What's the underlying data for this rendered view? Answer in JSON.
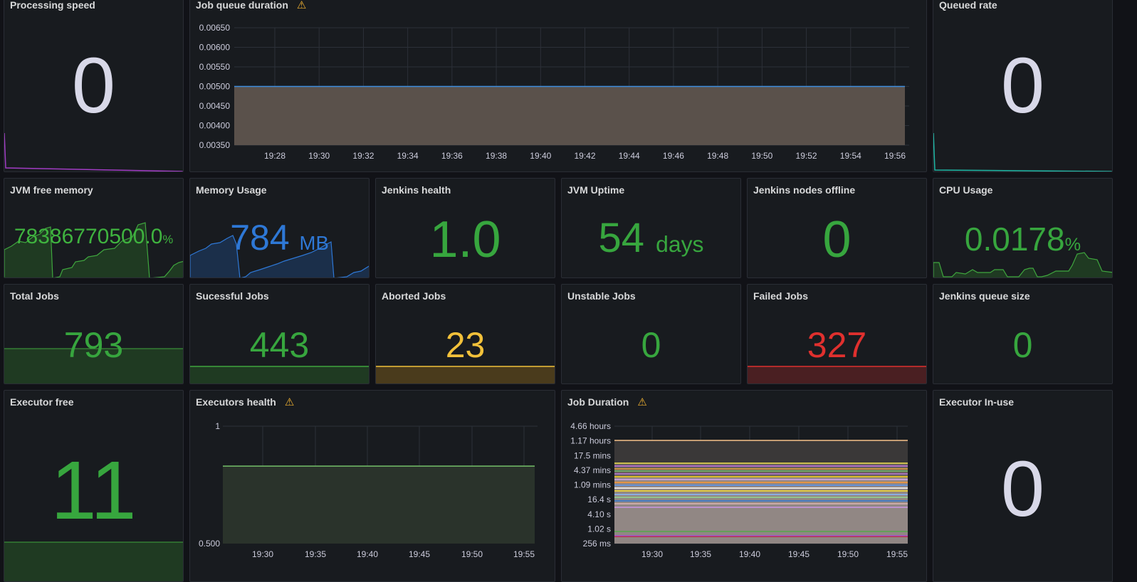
{
  "colors": {
    "background": "#111217",
    "panel": "#181b1f",
    "green": "#37a63e",
    "green_bright": "#3fb33f",
    "blue": "#2e78d6",
    "yellow": "#f2c13a",
    "red": "#e0302e",
    "neutral": "#d8d8e8",
    "warning": "#f2b331"
  },
  "panels": {
    "processing_speed": {
      "title": "Processing speed",
      "value": "0"
    },
    "job_queue_duration": {
      "title": "Job queue duration",
      "warning_icon": "warning-icon"
    },
    "queued_rate": {
      "title": "Queued rate",
      "value": "0"
    },
    "jvm_free_memory": {
      "title": "JVM free memory",
      "value": "78386770500.0",
      "unit": "%"
    },
    "memory_usage": {
      "title": "Memory Usage",
      "value": "784",
      "unit": "MB"
    },
    "jenkins_health": {
      "title": "Jenkins health",
      "value": "1.0"
    },
    "jvm_uptime": {
      "title": "JVM Uptime",
      "value": "54",
      "unit": "days"
    },
    "jenkins_nodes_offline": {
      "title": "Jenkins nodes offline",
      "value": "0"
    },
    "cpu_usage": {
      "title": "CPU Usage",
      "value": "0.0178",
      "unit": "%"
    },
    "total_jobs": {
      "title": "Total Jobs",
      "value": "793"
    },
    "successful_jobs": {
      "title": "Sucessful Jobs",
      "value": "443"
    },
    "aborted_jobs": {
      "title": "Aborted Jobs",
      "value": "23"
    },
    "unstable_jobs": {
      "title": "Unstable Jobs",
      "value": "0"
    },
    "failed_jobs": {
      "title": "Failed Jobs",
      "value": "327"
    },
    "jenkins_queue_size": {
      "title": "Jenkins queue size",
      "value": "0"
    },
    "executor_free": {
      "title": "Executor free",
      "value": "11"
    },
    "executors_health": {
      "title": "Executors health",
      "warning_icon": "warning-icon"
    },
    "job_duration": {
      "title": "Job Duration",
      "warning_icon": "warning-icon"
    },
    "executor_in_use": {
      "title": "Executor In-use",
      "value": "0"
    }
  },
  "chart_data": [
    {
      "type": "area",
      "panel": "Job queue duration",
      "y_ticks": [
        "0.00650",
        "0.00600",
        "0.00550",
        "0.00500",
        "0.00450",
        "0.00400",
        "0.00350"
      ],
      "x_ticks": [
        "19:28",
        "19:30",
        "19:32",
        "19:34",
        "19:36",
        "19:38",
        "19:40",
        "19:42",
        "19:44",
        "19:46",
        "19:48",
        "19:50",
        "19:52",
        "19:54",
        "19:56"
      ],
      "ylim": [
        0.0035,
        0.0065
      ],
      "series": [
        {
          "values": [
            0.005,
            0.005
          ]
        }
      ]
    },
    {
      "type": "area",
      "panel": "Executors health",
      "y_ticks": [
        "1",
        "0.500"
      ],
      "x_ticks": [
        "19:30",
        "19:35",
        "19:40",
        "19:45",
        "19:50",
        "19:55"
      ],
      "ylim": [
        0.5,
        1
      ],
      "series": [
        {
          "values": [
            0.83,
            0.83
          ]
        }
      ]
    },
    {
      "type": "line",
      "panel": "Job Duration",
      "y_ticks": [
        "4.66 hours",
        "1.17 hours",
        "17.5 mins",
        "4.37 mins",
        "1.09 mins",
        "16.4 s",
        "4.10 s",
        "1.02 s",
        "256 ms"
      ],
      "x_ticks": [
        "19:30",
        "19:35",
        "19:40",
        "19:45",
        "19:50",
        "19:55"
      ],
      "scale": "log"
    }
  ]
}
